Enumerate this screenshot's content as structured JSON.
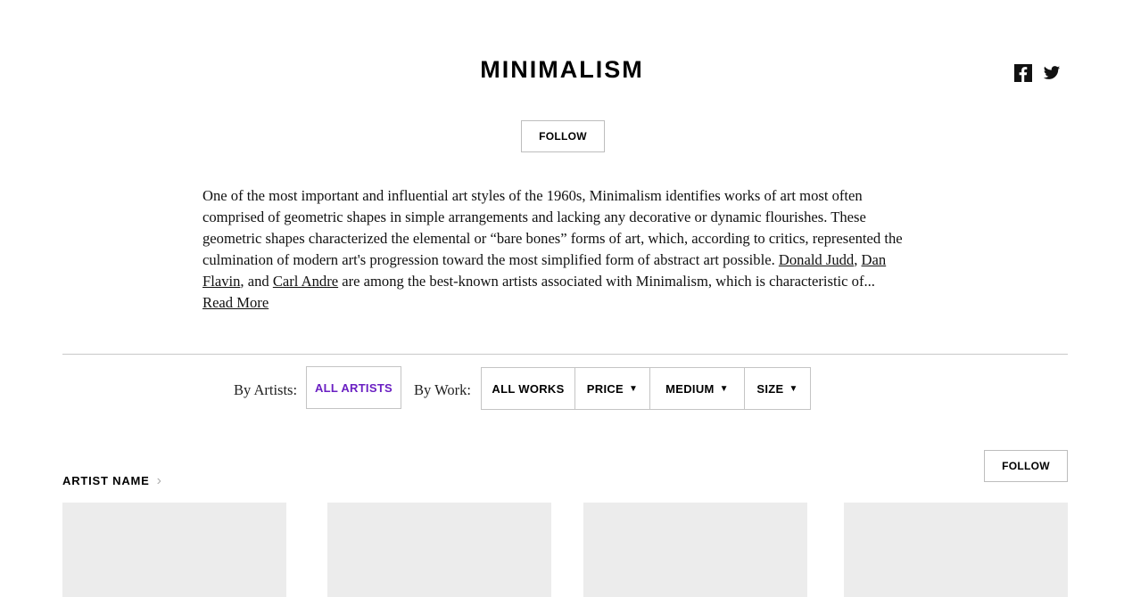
{
  "header": {
    "title": "MINIMALISM",
    "follow_label": "FOLLOW",
    "share_icons": [
      "facebook-icon",
      "twitter-icon"
    ]
  },
  "description": {
    "part1": "One of the most important and influential art styles of the 1960s, Minimalism identifies works of art most often comprised of geometric shapes in simple arrangements and lacking any decorative or dynamic flourishes. These geometric shapes characterized the elemental or “bare bones” forms of art, which, according to critics, represented the culmination of modern art's progression toward the most simplified form of abstract art possible. ",
    "link1": "Donald Judd",
    "sep1": ", ",
    "link2": "Dan Flavin",
    "sep2": ", and ",
    "link3": "Carl Andre",
    "part2": " are among the best-known artists associated with Minimalism, which is characteristic of...",
    "read_more": "Read More"
  },
  "filters": {
    "by_artists_label": "By Artists:",
    "all_artists": "ALL ARTISTS",
    "by_work_label": "By Work:",
    "all_works": "ALL WORKS",
    "price": "PRICE",
    "medium": "MEDIUM",
    "size": "SIZE",
    "caret": "▼",
    "active_color": "#6a1fc2"
  },
  "artist_section": {
    "name": "ARTIST NAME",
    "chevron": "›",
    "follow_label": "FOLLOW"
  }
}
